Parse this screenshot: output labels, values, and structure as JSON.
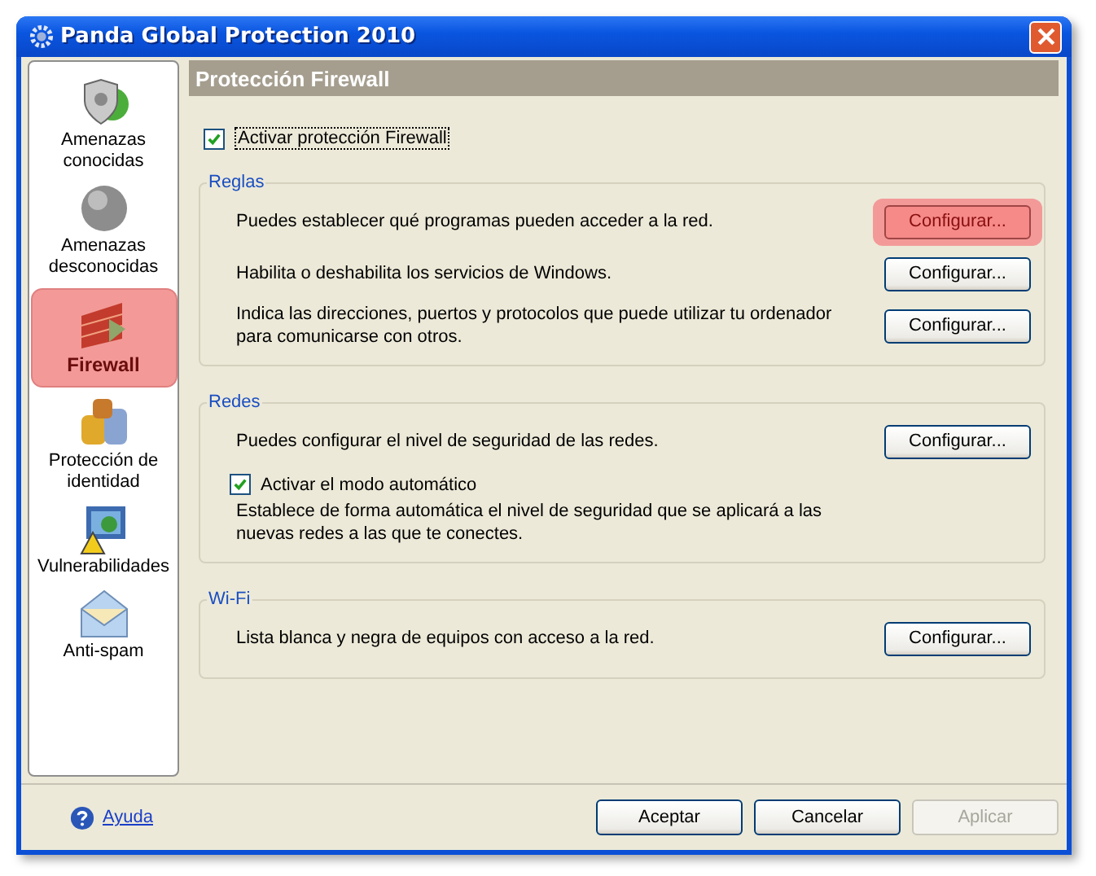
{
  "window": {
    "title": "Panda Global Protection 2010"
  },
  "sidebar": {
    "items": [
      {
        "kind": "shield",
        "label": "Amenazas conocidas",
        "selected": false
      },
      {
        "kind": "sphere",
        "label": "Amenazas desconocidas",
        "selected": false
      },
      {
        "kind": "wall",
        "label": "Firewall",
        "selected": true
      },
      {
        "kind": "coins",
        "label": "Protección de identidad",
        "selected": false
      },
      {
        "kind": "monitor",
        "label": "Vulnerabilidades",
        "selected": false
      },
      {
        "kind": "envelope",
        "label": "Anti-spam",
        "selected": false
      }
    ]
  },
  "panel": {
    "title": "Protección Firewall",
    "main_checkbox": {
      "label": "Activar protección Firewall",
      "checked": true
    },
    "groups": [
      {
        "title": "Reglas",
        "rows": [
          {
            "kind": "setting",
            "text": "Puedes establecer qué programas pueden acceder a la red.",
            "button": "Configurar...",
            "highlighted": true
          },
          {
            "kind": "setting",
            "text": "Habilita o deshabilita los servicios de Windows.",
            "button": "Configurar...",
            "highlighted": false
          },
          {
            "kind": "setting",
            "text": "Indica las direcciones, puertos y protocolos que puede utilizar tu ordenador para comunicarse con otros.",
            "button": "Configurar...",
            "highlighted": false
          }
        ]
      },
      {
        "title": "Redes",
        "rows": [
          {
            "kind": "setting",
            "text": "Puedes configurar el nivel de seguridad de las redes.",
            "button": "Configurar...",
            "highlighted": false
          },
          {
            "kind": "checkbox",
            "label": "Activar el modo automático",
            "checked": true,
            "description": "Establece de forma automática el nivel de seguridad que se aplicará a las nuevas redes a las que te conectes."
          }
        ]
      },
      {
        "title": "Wi-Fi",
        "rows": [
          {
            "kind": "setting",
            "text": "Lista blanca y negra de equipos con acceso a la red.",
            "button": "Configurar...",
            "highlighted": false
          }
        ]
      }
    ]
  },
  "footer": {
    "help": "Ayuda",
    "buttons": [
      {
        "label": "Aceptar",
        "disabled": false
      },
      {
        "label": "Cancelar",
        "disabled": false
      },
      {
        "label": "Aplicar",
        "disabled": true
      }
    ]
  }
}
